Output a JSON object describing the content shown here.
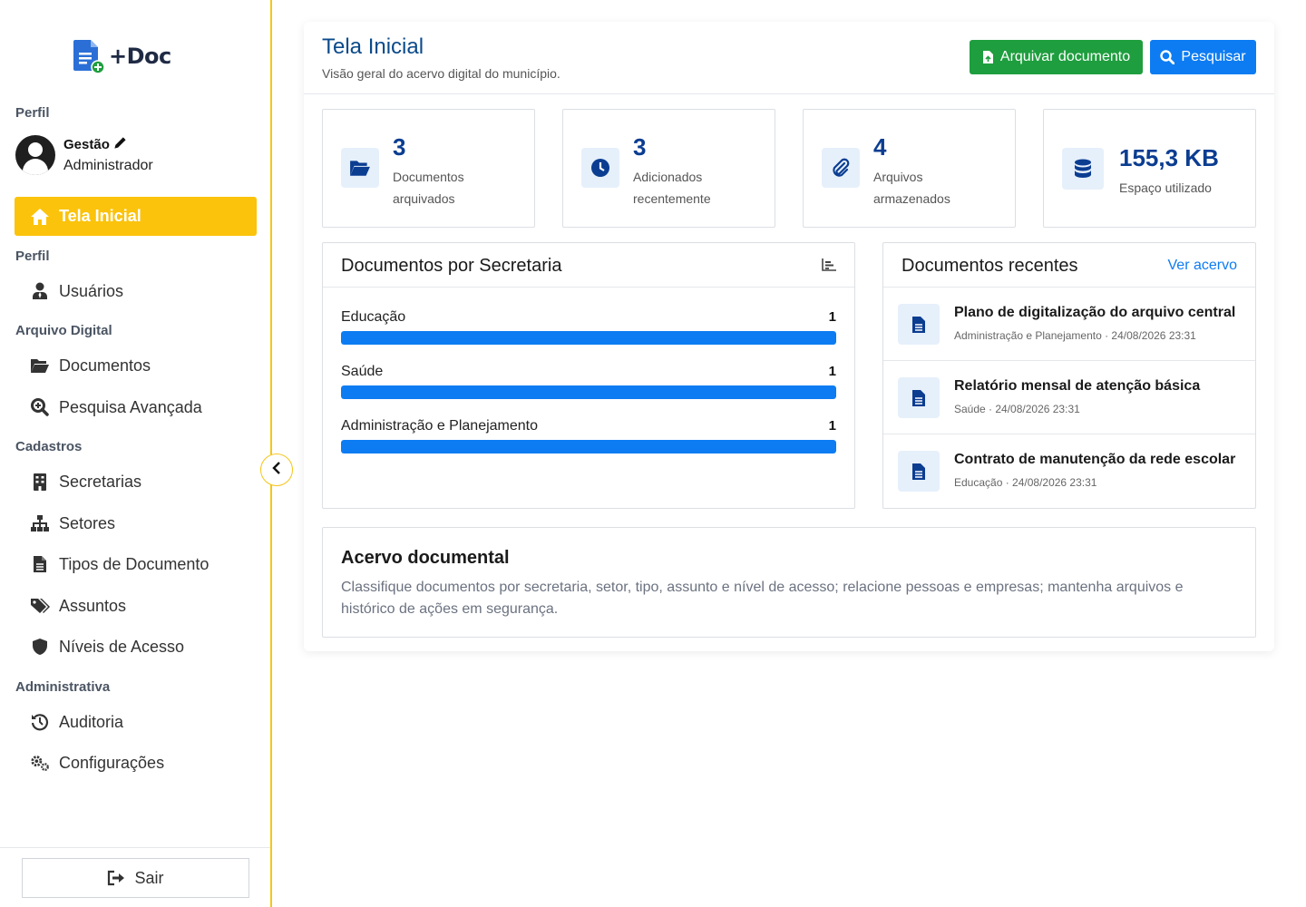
{
  "app": {
    "name": "+Doc"
  },
  "sidebar": {
    "profile_section": "Perfil",
    "profile_name": "Gestão",
    "profile_role": "Administrador",
    "active_item": {
      "label": "Tela Inicial",
      "icon": "home-icon"
    },
    "sections": [
      {
        "label": "Perfil",
        "items": [
          {
            "label": "Usuários",
            "icon": "user-tie-icon"
          }
        ]
      },
      {
        "label": "Arquivo Digital",
        "items": [
          {
            "label": "Documentos",
            "icon": "folder-open-icon"
          },
          {
            "label": "Pesquisa Avançada",
            "icon": "search-plus-icon"
          }
        ]
      },
      {
        "label": "Cadastros",
        "items": [
          {
            "label": "Secretarias",
            "icon": "building-icon"
          },
          {
            "label": "Setores",
            "icon": "sitemap-icon"
          },
          {
            "label": "Tipos de Documento",
            "icon": "file-alt-icon"
          },
          {
            "label": "Assuntos",
            "icon": "tags-icon"
          },
          {
            "label": "Níveis de Acesso",
            "icon": "shield-icon"
          }
        ]
      },
      {
        "label": "Administrativa",
        "items": [
          {
            "label": "Auditoria",
            "icon": "history-icon"
          },
          {
            "label": "Configurações",
            "icon": "cogs-icon"
          }
        ]
      }
    ],
    "logout_label": "Sair",
    "accent_color": "#fbc30b"
  },
  "main": {
    "title": "Tela Inicial",
    "subtitle": "Visão geral do acervo digital do município.",
    "buttons": {
      "archive_label": "Arquivar documento",
      "search_label": "Pesquisar"
    },
    "stats": [
      {
        "value": "3",
        "label": "Documentos arquivados",
        "icon": "folder-open-icon"
      },
      {
        "value": "3",
        "label": "Adicionados recentemente",
        "icon": "clock-icon"
      },
      {
        "value": "4",
        "label": "Arquivos armazenados",
        "icon": "paperclip-icon"
      },
      {
        "value": "155,3 KB",
        "label": "Espaço utilizado",
        "icon": "database-icon"
      }
    ],
    "by_department": {
      "title": "Documentos por Secretaria",
      "rows": [
        {
          "label": "Educação",
          "count": "1",
          "fill_fraction": 1
        },
        {
          "label": "Saúde",
          "count": "1",
          "fill_fraction": 1
        },
        {
          "label": "Administração e Planejamento",
          "count": "1",
          "fill_fraction": 1
        }
      ]
    },
    "recent": {
      "title": "Documentos recentes",
      "link": "Ver acervo",
      "items": [
        {
          "title": "Plano de digitalização do arquivo central",
          "meta": "Administração e Planejamento · 24/08/2026 23:31"
        },
        {
          "title": "Relatório mensal de atenção básica",
          "meta": "Saúde · 24/08/2026 23:31"
        },
        {
          "title": "Contrato de manutenção da rede escolar",
          "meta": "Educação · 24/08/2026 23:31"
        }
      ]
    },
    "acervo": {
      "title": "Acervo documental",
      "text": "Classifique documentos por secretaria, setor, tipo, assunto e nível de acesso; relacione pessoas e empresas; mantenha arquivos e histórico de ações em segurança."
    }
  },
  "colors": {
    "primary_blue": "#0d7cf2",
    "success_green": "#1e9e3e",
    "title_blue": "#0b4a8b",
    "stat_blue": "#0b3d91"
  }
}
